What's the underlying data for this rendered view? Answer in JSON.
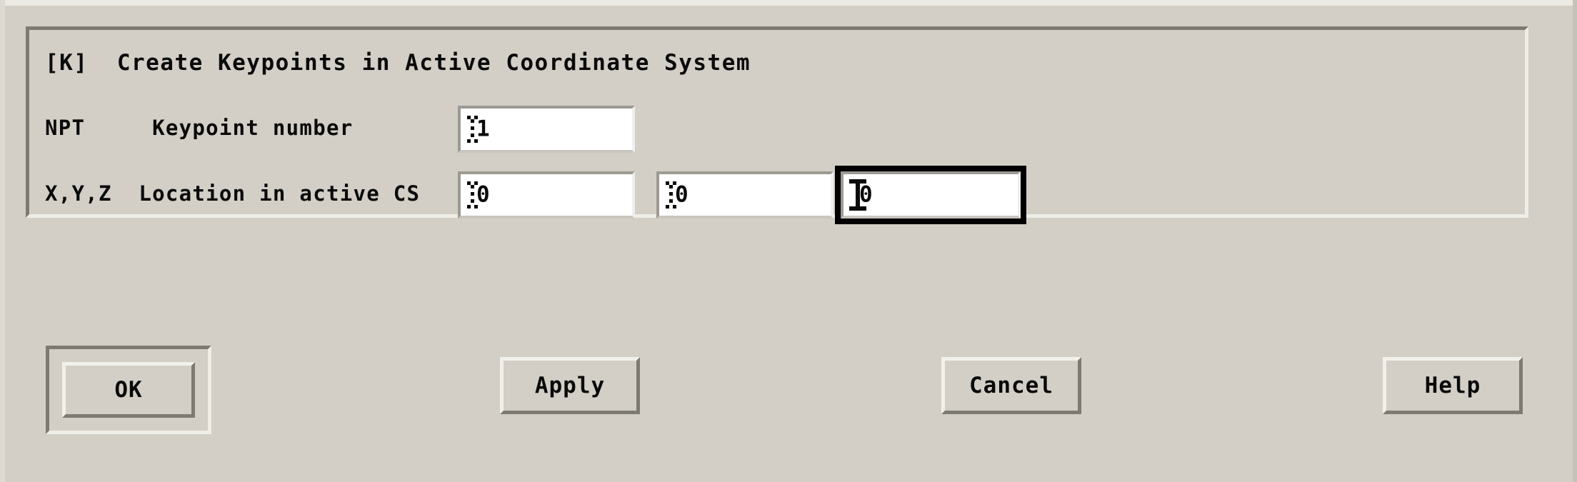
{
  "window": {
    "title": "Create Keypoints in Active Coordinate System",
    "background_color": "#d3cfc6"
  },
  "group": {
    "title": "[K]  Create Keypoints in Active Coordinate System"
  },
  "fields": [
    {
      "key": "npt",
      "name_label": "NPT",
      "description_label": "Keypoint number",
      "inputs": [
        {
          "key": "npt_value",
          "value": "1",
          "focused": false,
          "caret": "dotted"
        }
      ]
    },
    {
      "key": "xyz",
      "name_label": "X,Y,Z",
      "description_label": "Location in active CS",
      "inputs": [
        {
          "key": "x_value",
          "value": "0",
          "focused": false,
          "caret": "dotted"
        },
        {
          "key": "y_value",
          "value": "0",
          "focused": false,
          "caret": "dotted"
        },
        {
          "key": "z_value",
          "value": "0",
          "focused": true,
          "caret": "solid"
        }
      ]
    }
  ],
  "row_labels": {
    "npt": "NPT     Keypoint number",
    "xyz": "X,Y,Z  Location in active CS"
  },
  "buttons": {
    "ok": "OK",
    "apply": "Apply",
    "cancel": "Cancel",
    "help": "Help"
  },
  "colors": {
    "face": "#d3cfc6",
    "shadow": "#7d7a72",
    "highlight": "#f2f0eb",
    "field_background": "#ffffff",
    "text": "#0a0a0a",
    "focus_border": "#000000"
  }
}
